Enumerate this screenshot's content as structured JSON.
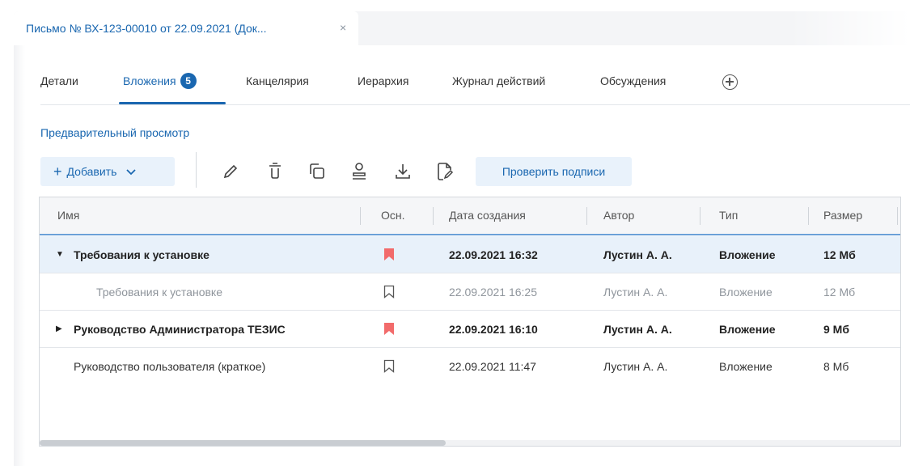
{
  "document_tab": {
    "title": "Письмо № ВХ-123-00010 от 22.09.2021 (Док...",
    "close": "×"
  },
  "tabs": [
    {
      "label": "Детали"
    },
    {
      "label": "Вложения",
      "badge": "5",
      "active": true
    },
    {
      "label": "Канцелярия"
    },
    {
      "label": "Иерархия"
    },
    {
      "label": "Журнал действий"
    },
    {
      "label": "Обсуждения"
    }
  ],
  "preview_link": "Предварительный просмотр",
  "toolbar": {
    "add_plus": "+",
    "add_label": "Добавить",
    "add_chevron": "⌄",
    "check_signatures": "Проверить подписи",
    "icons": [
      "edit-icon",
      "delete-icon",
      "copy-icon",
      "stamp-icon",
      "download-icon",
      "sign-icon"
    ]
  },
  "grid": {
    "columns": [
      "Имя",
      "Осн.",
      "Дата создания",
      "Автор",
      "Тип",
      "Размер"
    ],
    "rows": [
      {
        "name": "Требования к установке",
        "main": true,
        "date": "22.09.2021 16:32",
        "author": "Лустин А. А.",
        "type": "Вложение",
        "size": "12 Мб",
        "expander": "▼",
        "style": "bold",
        "selected": true
      },
      {
        "name": "Требования к установке",
        "main": false,
        "date": "22.09.2021 16:25",
        "author": "Лустин А. А.",
        "type": "Вложение",
        "size": "12 Мб",
        "expander": "",
        "style": "muted",
        "selected": false
      },
      {
        "name": "Руководство Администратора ТЕЗИС",
        "main": true,
        "date": "22.09.2021 16:10",
        "author": "Лустин А. А.",
        "type": "Вложение",
        "size": "9 Мб",
        "expander": "▶",
        "style": "bold",
        "selected": false
      },
      {
        "name": "Руководство пользователя (краткое)",
        "main": false,
        "date": "22.09.2021 11:47",
        "author": "Лустин А. А.",
        "type": "Вложение",
        "size": "8 Мб",
        "expander": "",
        "style": "normal",
        "selected": false
      }
    ]
  },
  "colors": {
    "accent": "#1a67b0",
    "bookmark_main": "#f26b6b",
    "selected_row": "#e8f1fa"
  }
}
